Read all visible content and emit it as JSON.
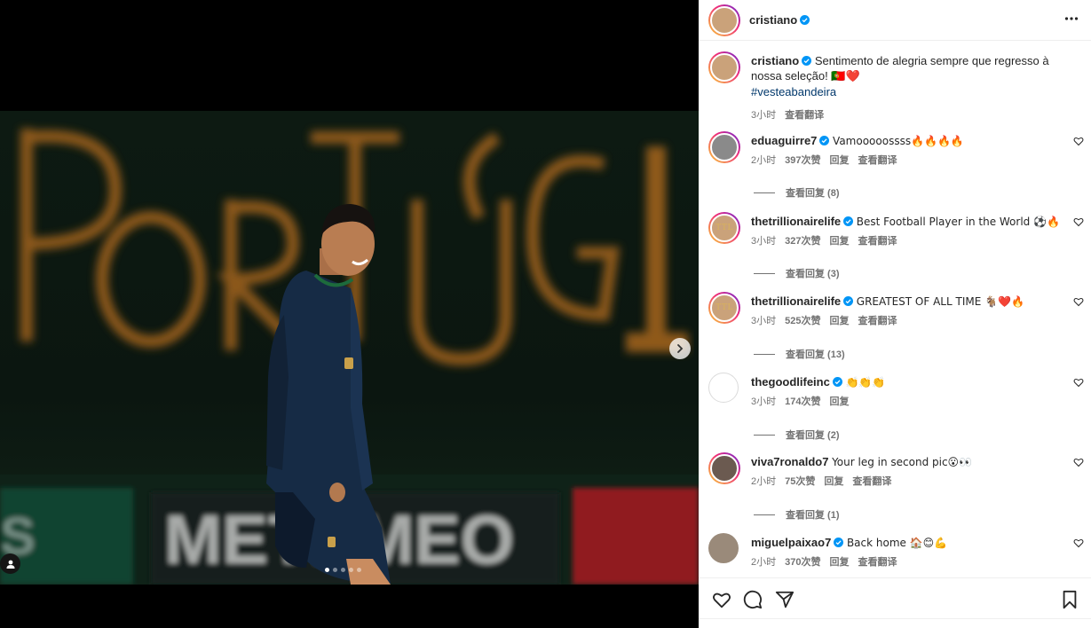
{
  "post": {
    "username": "cristiano",
    "caption": "Sentimento de alegria sempre que regresso à nossa seleção! 🇵🇹❤️",
    "hashtag": "#vesteabandeira",
    "time": "3小时",
    "see_translation": "查看翻译"
  },
  "media": {
    "watermark_text": "PORTUGAL",
    "sponsor_text": "MEO",
    "slide_count": 5,
    "active_slide": 1
  },
  "labels": {
    "reply": "回复"
  },
  "comments": [
    {
      "username": "eduaguirre7",
      "verified": true,
      "text": "Vamooooossss🔥🔥🔥🔥",
      "time": "2小时",
      "likes": "397次赞",
      "translate": "查看翻译",
      "replies": "查看回复 (8)",
      "avatar": "photo"
    },
    {
      "username": "thetrillionairelife",
      "verified": true,
      "text": "Best Football Player in the World ⚽🔥",
      "time": "3小时",
      "likes": "327次赞",
      "translate": "查看翻译",
      "replies": "查看回复 (3)",
      "avatar": "TTL"
    },
    {
      "username": "thetrillionairelife",
      "verified": true,
      "text": "GREATEST OF ALL TIME 🐐❤️🔥",
      "time": "3小时",
      "likes": "525次赞",
      "translate": "查看翻译",
      "replies": "查看回复 (13)",
      "avatar": "TTL"
    },
    {
      "username": "thegoodlifeinc",
      "verified": true,
      "text": "👏👏👏",
      "time": "3小时",
      "likes": "174次赞",
      "translate": "",
      "replies": "查看回复 (2)",
      "avatar": "plain"
    },
    {
      "username": "viva7ronaldo7",
      "verified": false,
      "text": "Your leg in second pic😮👀",
      "time": "2小时",
      "likes": "75次赞",
      "translate": "查看翻译",
      "replies": "查看回复 (1)",
      "avatar": "photo"
    },
    {
      "username": "miguelpaixao7",
      "verified": true,
      "text": "Back home 🏠😊💪",
      "time": "2小时",
      "likes": "370次赞",
      "translate": "查看翻译",
      "replies": "",
      "avatar": "photo"
    }
  ],
  "colors": {
    "link": "#00376b",
    "meta": "#737373",
    "verified": "#0095f6"
  }
}
